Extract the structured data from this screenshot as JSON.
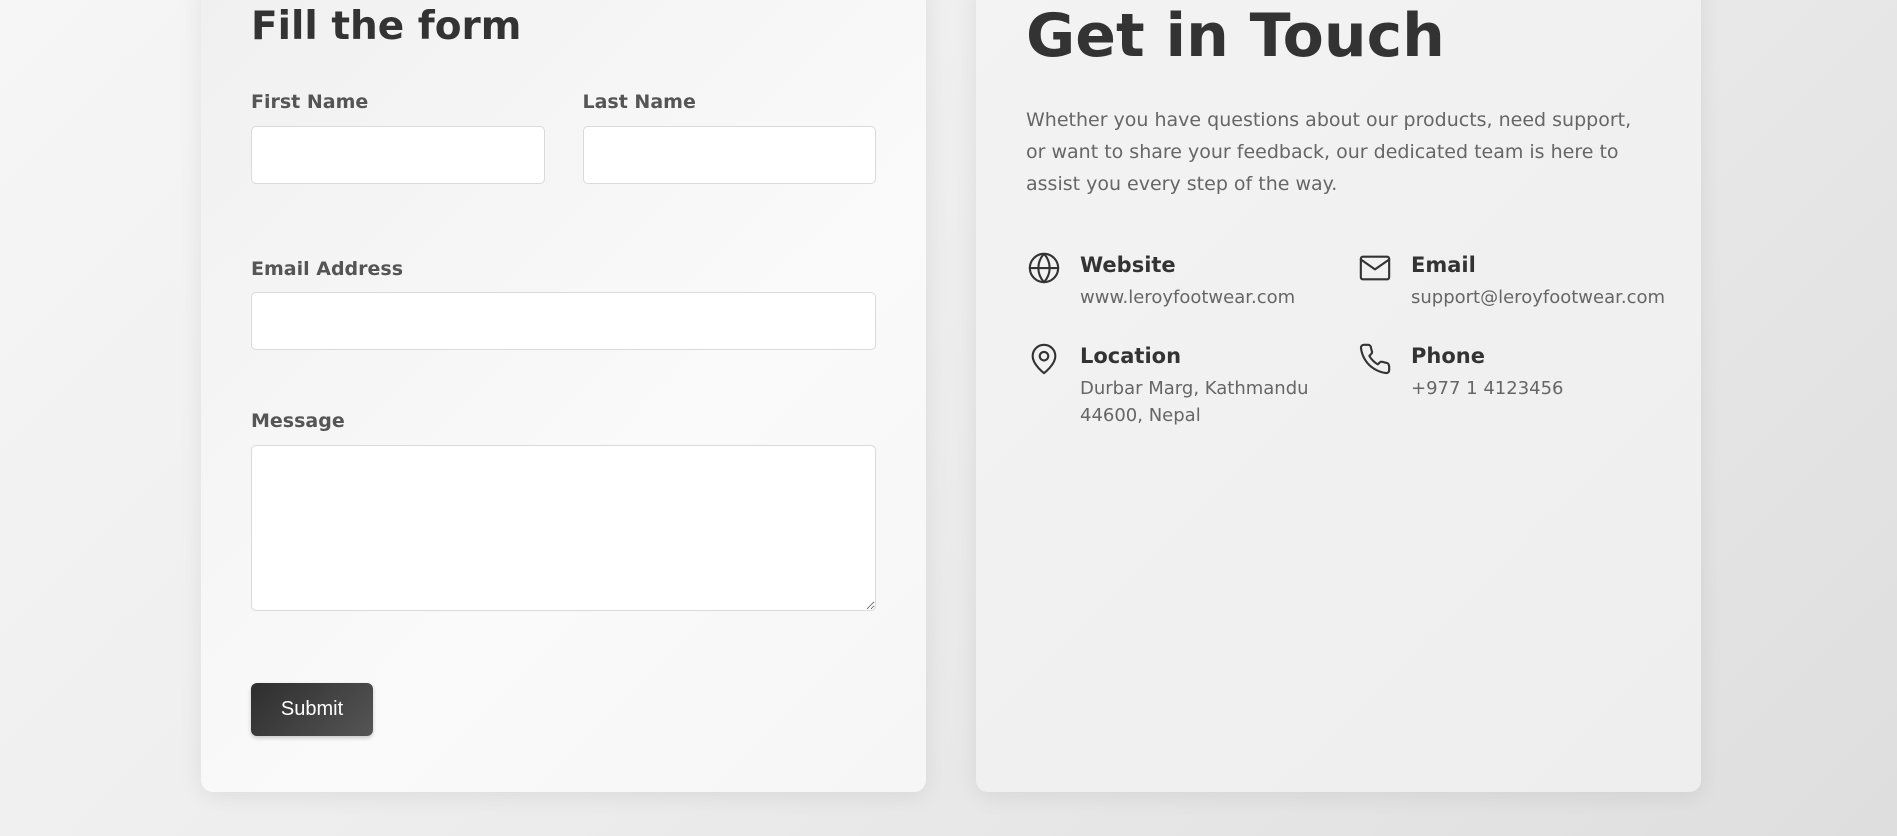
{
  "form": {
    "title": "Fill the form",
    "first_name_label": "First Name",
    "last_name_label": "Last Name",
    "email_label": "Email Address",
    "message_label": "Message",
    "first_name_value": "",
    "last_name_value": "",
    "email_value": "",
    "message_value": "",
    "submit_label": "Submit"
  },
  "info": {
    "title": "Get in Touch",
    "description": "Whether you have questions about our products, need support, or want to share your feedback, our dedicated team is here to assist you every step of the way.",
    "items": [
      {
        "icon": "globe-icon",
        "heading": "Website",
        "value": "www.leroyfootwear.com"
      },
      {
        "icon": "mail-icon",
        "heading": "Email",
        "value": "support@leroyfootwear.com"
      },
      {
        "icon": "map-pin-icon",
        "heading": "Location",
        "value": "Durbar Marg, Kathmandu 44600, Nepal"
      },
      {
        "icon": "phone-icon",
        "heading": "Phone",
        "value": "+977 1 4123456"
      }
    ]
  },
  "colors": {
    "heading": "#333333",
    "body_text": "#666666",
    "button_bg": "#3a3a3a",
    "button_text": "#ffffff"
  }
}
